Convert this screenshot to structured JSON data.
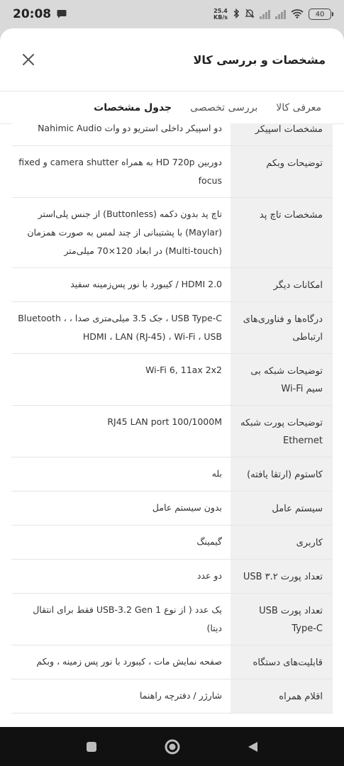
{
  "status_bar": {
    "time": "20:08",
    "speed_value": "25.4",
    "speed_unit": "KB/s",
    "battery": "40"
  },
  "sheet": {
    "title": "مشخصات و بررسی کالا"
  },
  "tabs": [
    {
      "label": "معرفی کالا"
    },
    {
      "label": "بررسی تخصصی"
    },
    {
      "label": "جدول مشخصات"
    }
  ],
  "specs": [
    {
      "key": "مشخصات اسپیکر",
      "value": "دو اسپیکر داخلی استریو دو وات Nahimic Audio"
    },
    {
      "key": "توضیحات وبکم",
      "value": "دوربین HD 720p به همراه camera shutter و fixed focus"
    },
    {
      "key": "مشخصات تاچ پد",
      "value": "تاچ پد بدون دکمه (Buttonless) از جنس پلی‌استر (Maylar) با پشتیبانی از چند لمس به صورت همزمان (Multi-touch) در ابعاد 120×70 میلی‌متر"
    },
    {
      "key": "امکانات دیگر",
      "value": "HDMI 2.0 / کیبورد با نور پس‌زمینه سفید"
    },
    {
      "key": "درگاه‌ها و فناوری‌های ارتباطی",
      "value": "USB Type-C ، جک 3.5 میلی‌متری صدا ، Bluetooth ، HDMI ، LAN (RJ-45) ، Wi-Fi ، USB"
    },
    {
      "key": "توضیحات شبکه بی سیم Wi-Fi",
      "value": "Wi-Fi 6, 11ax 2x2"
    },
    {
      "key": "توضیحات پورت شبکه Ethernet",
      "value": "RJ45 LAN port 100/1000M"
    },
    {
      "key": "کاستوم (ارتقا یافته)",
      "value": "بله"
    },
    {
      "key": "سیستم عامل",
      "value": "بدون سیستم عامل"
    },
    {
      "key": "کاربری",
      "value": "گیمینگ"
    },
    {
      "key": "تعداد پورت USB ۳.۲",
      "value": "دو عدد"
    },
    {
      "key": "تعداد پورت USB Type-C",
      "value": "یک عدد ( از نوع USB-3.2 Gen 1 فقط برای انتقال دیتا)"
    },
    {
      "key": "قابلیت‌های دستگاه",
      "value": "صفحه نمایش مات ، کیبورد با نور پس زمینه ، وبکم"
    },
    {
      "key": "اقلام همراه",
      "value": "شارژر / دفترچه راهنما"
    }
  ]
}
